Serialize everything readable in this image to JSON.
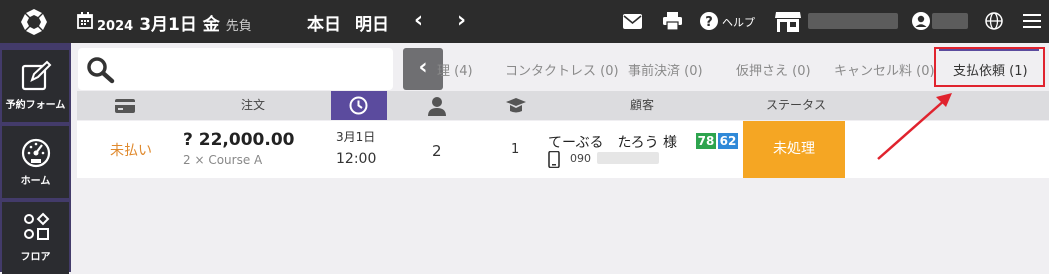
{
  "topbar": {
    "year": "2024",
    "date": "3月1日 金",
    "rokuyo": "先負",
    "today": "本日",
    "tomorrow": "明日",
    "prev": "‹",
    "next": "›",
    "help_label": "ヘルプ"
  },
  "sidebar": {
    "items": [
      {
        "label": "予約フォーム",
        "icon": "edit-icon"
      },
      {
        "label": "ホーム",
        "icon": "dashboard-icon"
      },
      {
        "label": "フロア",
        "icon": "floor-icon"
      }
    ]
  },
  "search": {
    "placeholder": ""
  },
  "tabs": [
    {
      "label": "理 (4)"
    },
    {
      "label": "コンタクトレス (0)"
    },
    {
      "label": "事前決済 (0)"
    },
    {
      "label": "仮押さえ (0)"
    },
    {
      "label": "キャンセル料 (0)"
    },
    {
      "label": "支払依頼 (1)",
      "active": true
    }
  ],
  "table": {
    "headers": {
      "order": "注文",
      "customer": "顧客",
      "status": "ステータス"
    },
    "rows": [
      {
        "payment_status": "未払い",
        "amount": "? 22,000.00",
        "course": "2 × Course A",
        "date": "3月1日",
        "time": "12:00",
        "guests": "2",
        "tables": "1",
        "customer_name": "てーぶる　たろう 様",
        "phone": "090",
        "badge_green": "78",
        "badge_blue": "62",
        "status": "未処理"
      }
    ]
  },
  "colors": {
    "topbar": "#2c2c2c",
    "sidebar": "#433b6a",
    "accent": "#5b4b9e",
    "status_pending": "#f5a623",
    "unpaid": "#e08a2e",
    "highlight": "#e0232e"
  }
}
